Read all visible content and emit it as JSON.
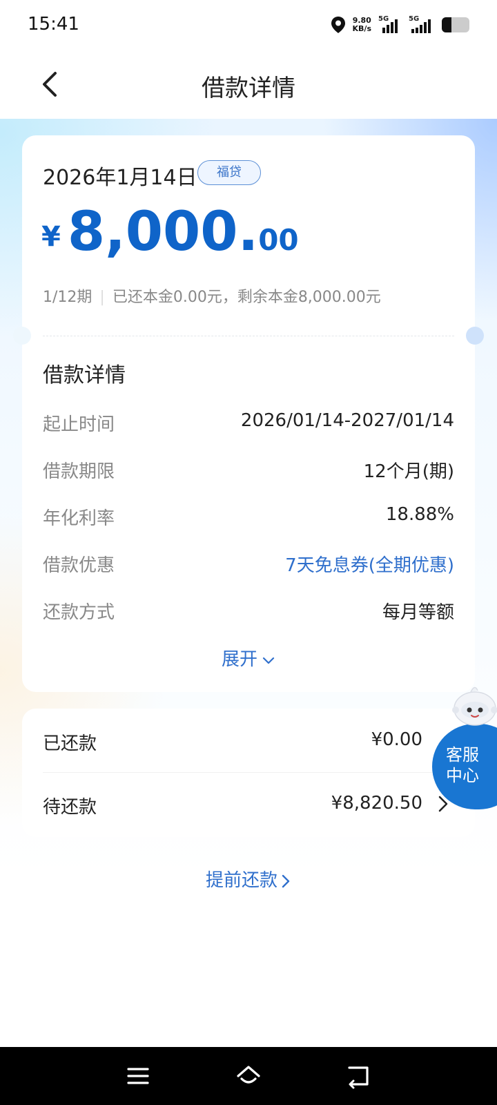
{
  "status_bar": {
    "time": "15:41",
    "net_speed_value": "9.80",
    "net_speed_unit": "KB/s",
    "sim1": "5G",
    "sim2": "5G",
    "icons": [
      "location-icon",
      "signal-icon",
      "battery-icon"
    ]
  },
  "header": {
    "title": "借款详情",
    "back_icon": "chevron-left-icon"
  },
  "loan": {
    "date": "2026年1月14日",
    "tag": "福贷",
    "currency_symbol": "¥",
    "amount_integer": "8,000.",
    "amount_decimal": "00",
    "period": "1/12期",
    "progress_text": "已还本金0.00元，剩余本金8,000.00元"
  },
  "details": {
    "title": "借款详情",
    "rows": [
      {
        "label": "起止时间",
        "value": "2026/01/14-2027/01/14"
      },
      {
        "label": "借款期限",
        "value": "12个月(期)"
      },
      {
        "label": "年化利率",
        "value": "18.88%"
      },
      {
        "label": "借款优惠",
        "value": "7天免息券(全期优惠)"
      },
      {
        "label": "还款方式",
        "value": "每月等额"
      }
    ],
    "expand_label": "展开"
  },
  "repayment": {
    "paid_label": "已还款",
    "paid_value": "¥0.00",
    "pending_label": "待还款",
    "pending_value": "¥8,820.50"
  },
  "prepay": {
    "label": "提前还款"
  },
  "service": {
    "label": "客服中心"
  },
  "colors": {
    "accent": "#0f64c9",
    "link": "#2f6fcc",
    "service_bg": "#1976d2"
  },
  "system_nav": {
    "icons": [
      "menu-icon",
      "home-icon",
      "back-icon"
    ]
  }
}
